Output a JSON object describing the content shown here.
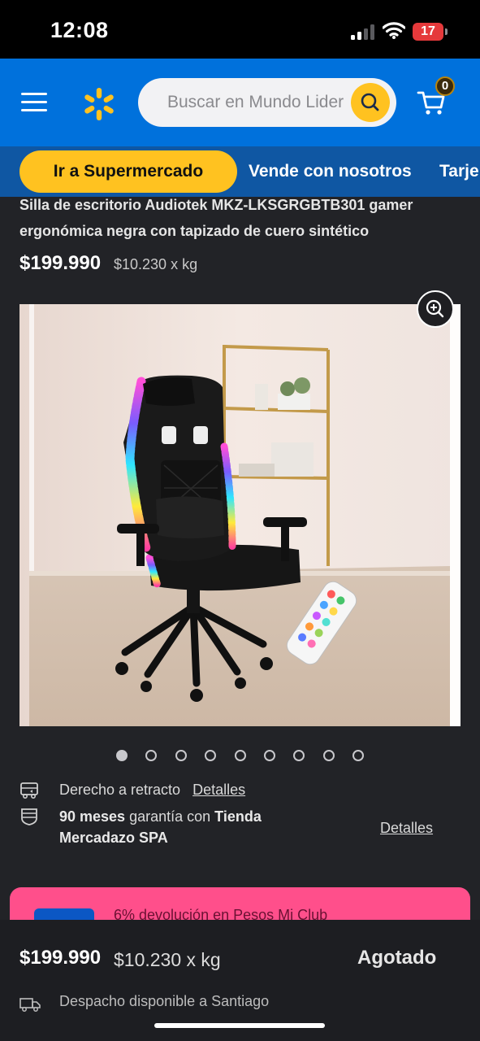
{
  "status_bar": {
    "time": "12:08",
    "battery": "17"
  },
  "header": {
    "search_placeholder": "Buscar en Mundo Lider",
    "cart_count": "0",
    "brand_color": "#0071dc",
    "accent_color": "#ffc220"
  },
  "nav": {
    "supermarket_label": "Ir a Supermercado",
    "links": [
      "Vende con nosotros",
      "Tarje"
    ]
  },
  "product": {
    "title": "Silla de escritorio Audiotek MKZ-LKSGRGBTB301 gamer ergonómica negra con tapizado de cuero sintético",
    "price": "$199.990",
    "unit_price": "$10.230 x kg",
    "image_count": 9,
    "active_image_index": 0
  },
  "info": {
    "return_label": "Derecho a retracto",
    "return_link": "Detalles",
    "warranty_months": "90 meses",
    "warranty_mid": " garantía con ",
    "warranty_store": "Tienda Mercadazo SPA",
    "warranty_link": "Detalles"
  },
  "promo": {
    "text": "6% devolución en Pesos Mi Club"
  },
  "bottom_bar": {
    "price": "$199.990",
    "unit_price": "$10.230 x kg",
    "stock_status": "Agotado",
    "delivery": "Despacho disponible a Santiago"
  }
}
